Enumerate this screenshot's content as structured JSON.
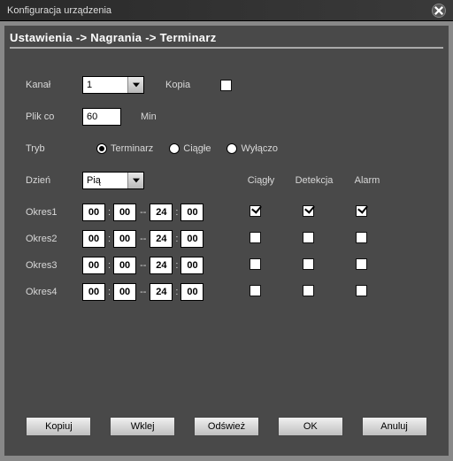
{
  "title": "Konfiguracja urządzenia",
  "breadcrumb": "Ustawienia -> Nagrania -> Terminarz",
  "labels": {
    "kanal": "Kanał",
    "kopia": "Kopia",
    "plikco": "Plik co",
    "min": "Min",
    "tryb": "Tryb",
    "dzien": "Dzień"
  },
  "kanal": {
    "value": "1"
  },
  "plikco": {
    "value": "60"
  },
  "tryb": {
    "terminarz": "Terminarz",
    "ciagle": "Ciągłe",
    "wylaczo": "Wyłączo",
    "selected": "terminarz"
  },
  "dzien": {
    "value": "Pią"
  },
  "columns": {
    "ciagly": "Ciągły",
    "detekcja": "Detekcja",
    "alarm": "Alarm"
  },
  "periods": [
    {
      "label": "Okres1",
      "h1": "00",
      "m1": "00",
      "h2": "24",
      "m2": "00",
      "ciagly": true,
      "detekcja": true,
      "alarm": true
    },
    {
      "label": "Okres2",
      "h1": "00",
      "m1": "00",
      "h2": "24",
      "m2": "00",
      "ciagly": false,
      "detekcja": false,
      "alarm": false
    },
    {
      "label": "Okres3",
      "h1": "00",
      "m1": "00",
      "h2": "24",
      "m2": "00",
      "ciagly": false,
      "detekcja": false,
      "alarm": false
    },
    {
      "label": "Okres4",
      "h1": "00",
      "m1": "00",
      "h2": "24",
      "m2": "00",
      "ciagly": false,
      "detekcja": false,
      "alarm": false
    }
  ],
  "buttons": {
    "kopiuj": "Kopiuj",
    "wklej": "Wklej",
    "odswiez": "Odśwież",
    "ok": "OK",
    "anuluj": "Anuluj"
  }
}
